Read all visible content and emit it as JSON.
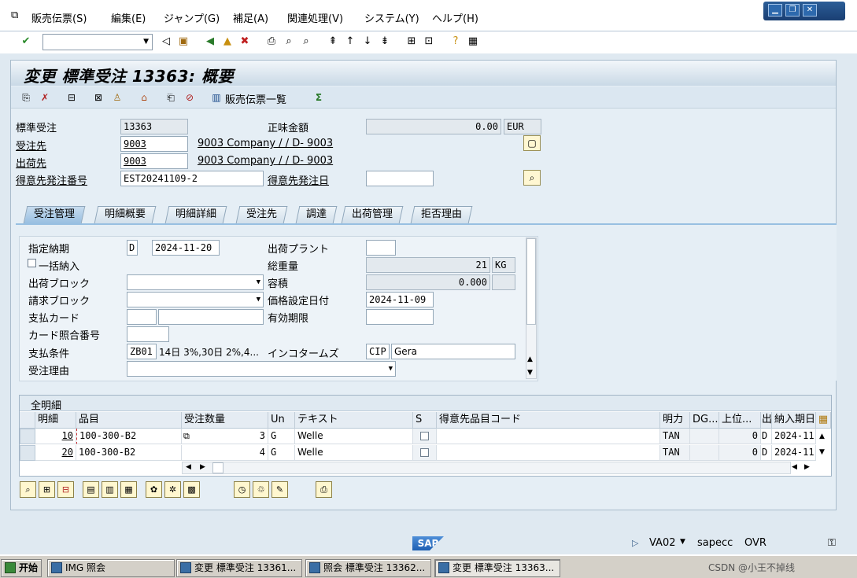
{
  "menu": [
    "販売伝票(S)",
    "編集(E)",
    "ジャンプ(G)",
    "補足(A)",
    "関連処理(V)",
    "システム(Y)",
    "ヘルプ(H)"
  ],
  "window_title": "変更 標準受注 13363: 概要",
  "app_toolbar": {
    "sales_doc_list": "販売伝票一覧"
  },
  "header": {
    "std_order_label": "標準受注",
    "std_order_value": "13363",
    "net_value_label": "正味金額",
    "net_value": "0.00",
    "currency": "EUR",
    "sold_to_label": "受注先",
    "sold_to_value": "9003",
    "sold_to_desc": "9003 Company / / D- 9003",
    "ship_to_label": "出荷先",
    "ship_to_value": "9003",
    "ship_to_desc": "9003 Company / / D- 9003",
    "po_number_label": "得意先発注番号",
    "po_number_value": "EST20241109-2",
    "po_date_label": "得意先発注日",
    "po_date_value": ""
  },
  "tabs": [
    "受注管理",
    "明細概要",
    "明細詳細",
    "受注先",
    "調達",
    "出荷管理",
    "拒否理由"
  ],
  "form": {
    "req_delivery_label": "指定納期",
    "req_delivery_type": "D",
    "req_delivery_date": "2024-11-20",
    "delivering_plant_label": "出荷プラント",
    "delivering_plant_value": "",
    "complete_delivery_label": "一括納入",
    "total_weight_label": "総重量",
    "total_weight_value": "21",
    "weight_unit": "KG",
    "delivery_block_label": "出荷ブロック",
    "volume_label": "容積",
    "volume_value": "0.000",
    "billing_block_label": "請求ブロック",
    "pricing_date_label": "価格設定日付",
    "pricing_date_value": "2024-11-09",
    "payment_card_label": "支払カード",
    "valid_to_label": "有効期限",
    "card_verif_label": "カード照合番号",
    "payment_terms_label": "支払条件",
    "payment_terms_value": "ZB01",
    "payment_terms_desc": "14日 3%,30日 2%,4...",
    "incoterms_label": "インコタームズ",
    "incoterms_value": "CIP",
    "incoterms_desc": "Gera",
    "order_reason_label": "受注理由"
  },
  "grid": {
    "title": "全明細",
    "columns": [
      "明細",
      "品目",
      "受注数量",
      "Un",
      "テキスト",
      "S",
      "得意先品目コード",
      "明力",
      "DG...",
      "上位...",
      "出",
      "納入期日"
    ],
    "rows": [
      {
        "item": "10",
        "material": "100-300-B2",
        "qty": "3",
        "unit": "G",
        "text": "Welle",
        "cat": "TAN",
        "hl": "0",
        "dv": "D",
        "date": "2024-11"
      },
      {
        "item": "20",
        "material": "100-300-B2",
        "qty": "4",
        "unit": "G",
        "text": "Welle",
        "cat": "TAN",
        "hl": "0",
        "dv": "D",
        "date": "2024-11"
      }
    ]
  },
  "status": {
    "sap": "SAP",
    "tcode": "VA02",
    "server": "sapecc",
    "mode": "OVR"
  },
  "taskbar": {
    "start": "开始",
    "tasks": [
      "IMG 照会",
      "変更 標準受注 13361...",
      "照会 標準受注 13362...",
      "変更 標準受注 13363..."
    ],
    "tray": "CSDN @小王不掉线"
  }
}
